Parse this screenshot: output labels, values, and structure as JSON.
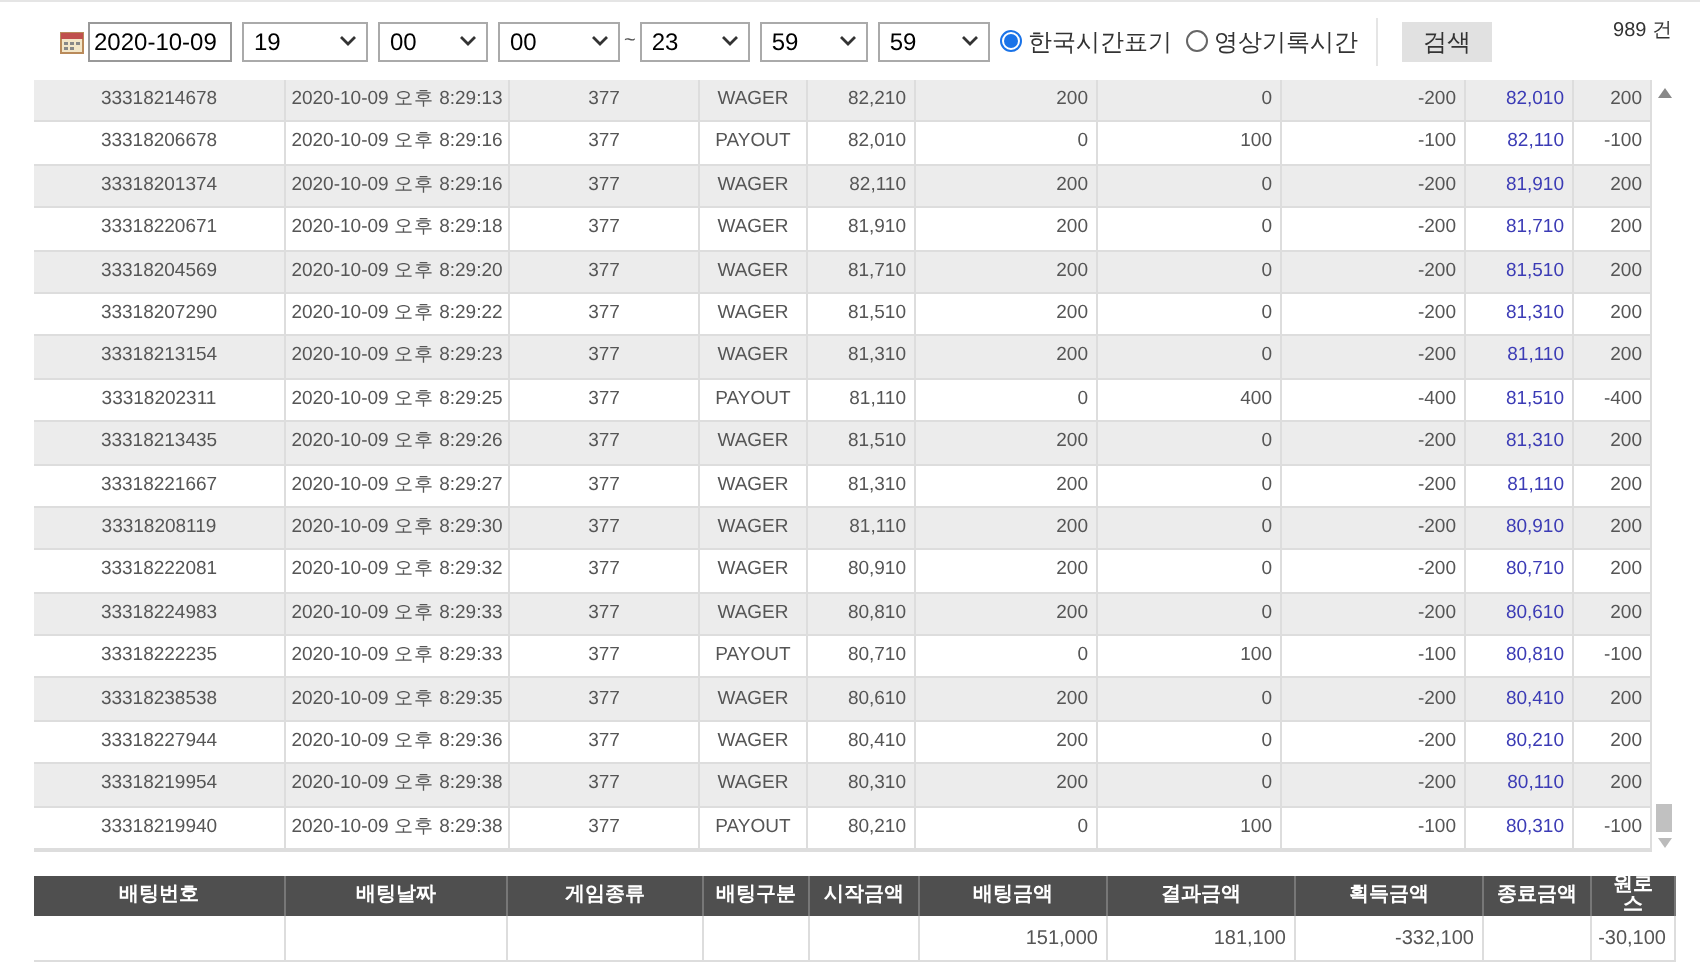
{
  "filter": {
    "date": "2020-10-09",
    "from": [
      "19",
      "00",
      "00"
    ],
    "separator": "~",
    "to": [
      "23",
      "59",
      "59"
    ],
    "time_modes": [
      {
        "label": "한국시간표기",
        "selected": true
      },
      {
        "label": "영상기록시간",
        "selected": false
      }
    ],
    "search_button": "검색",
    "count": "989 건"
  },
  "table": {
    "rows": [
      {
        "cells": [
          "33318214678",
          "2020-10-09 오후 8:29:13",
          "377",
          "WAGER",
          "82,210",
          "200",
          "0",
          "-200",
          "82,010",
          "200"
        ]
      },
      {
        "cells": [
          "33318206678",
          "2020-10-09 오후 8:29:16",
          "377",
          "PAYOUT",
          "82,010",
          "0",
          "100",
          "-100",
          "82,110",
          "-100"
        ]
      },
      {
        "cells": [
          "33318201374",
          "2020-10-09 오후 8:29:16",
          "377",
          "WAGER",
          "82,110",
          "200",
          "0",
          "-200",
          "81,910",
          "200"
        ]
      },
      {
        "cells": [
          "33318220671",
          "2020-10-09 오후 8:29:18",
          "377",
          "WAGER",
          "81,910",
          "200",
          "0",
          "-200",
          "81,710",
          "200"
        ]
      },
      {
        "cells": [
          "33318204569",
          "2020-10-09 오후 8:29:20",
          "377",
          "WAGER",
          "81,710",
          "200",
          "0",
          "-200",
          "81,510",
          "200"
        ]
      },
      {
        "cells": [
          "33318207290",
          "2020-10-09 오후 8:29:22",
          "377",
          "WAGER",
          "81,510",
          "200",
          "0",
          "-200",
          "81,310",
          "200"
        ]
      },
      {
        "cells": [
          "33318213154",
          "2020-10-09 오후 8:29:23",
          "377",
          "WAGER",
          "81,310",
          "200",
          "0",
          "-200",
          "81,110",
          "200"
        ]
      },
      {
        "cells": [
          "33318202311",
          "2020-10-09 오후 8:29:25",
          "377",
          "PAYOUT",
          "81,110",
          "0",
          "400",
          "-400",
          "81,510",
          "-400"
        ]
      },
      {
        "cells": [
          "33318213435",
          "2020-10-09 오후 8:29:26",
          "377",
          "WAGER",
          "81,510",
          "200",
          "0",
          "-200",
          "81,310",
          "200"
        ]
      },
      {
        "cells": [
          "33318221667",
          "2020-10-09 오후 8:29:27",
          "377",
          "WAGER",
          "81,310",
          "200",
          "0",
          "-200",
          "81,110",
          "200"
        ]
      },
      {
        "cells": [
          "33318208119",
          "2020-10-09 오후 8:29:30",
          "377",
          "WAGER",
          "81,110",
          "200",
          "0",
          "-200",
          "80,910",
          "200"
        ]
      },
      {
        "cells": [
          "33318222081",
          "2020-10-09 오후 8:29:32",
          "377",
          "WAGER",
          "80,910",
          "200",
          "0",
          "-200",
          "80,710",
          "200"
        ]
      },
      {
        "cells": [
          "33318224983",
          "2020-10-09 오후 8:29:33",
          "377",
          "WAGER",
          "80,810",
          "200",
          "0",
          "-200",
          "80,610",
          "200"
        ]
      },
      {
        "cells": [
          "33318222235",
          "2020-10-09 오후 8:29:33",
          "377",
          "PAYOUT",
          "80,710",
          "0",
          "100",
          "-100",
          "80,810",
          "-100"
        ]
      },
      {
        "cells": [
          "33318238538",
          "2020-10-09 오후 8:29:35",
          "377",
          "WAGER",
          "80,610",
          "200",
          "0",
          "-200",
          "80,410",
          "200"
        ]
      },
      {
        "cells": [
          "33318227944",
          "2020-10-09 오후 8:29:36",
          "377",
          "WAGER",
          "80,410",
          "200",
          "0",
          "-200",
          "80,210",
          "200"
        ]
      },
      {
        "cells": [
          "33318219954",
          "2020-10-09 오후 8:29:38",
          "377",
          "WAGER",
          "80,310",
          "200",
          "0",
          "-200",
          "80,110",
          "200"
        ]
      },
      {
        "cells": [
          "33318219940",
          "2020-10-09 오후 8:29:38",
          "377",
          "PAYOUT",
          "80,210",
          "0",
          "100",
          "-100",
          "80,310",
          "-100"
        ]
      }
    ]
  },
  "summary": {
    "columns": [
      "배팅번호",
      "배팅날짜",
      "게임종류",
      "배팅구분",
      "시작금액",
      "배팅금액",
      "결과금액",
      "획득금액",
      "종료금액",
      "원로스"
    ],
    "totals": {
      "bet_amount": "151,000",
      "result_amount": "181,100",
      "gain_amount": "-332,100",
      "win_loss": "-30,100"
    }
  }
}
